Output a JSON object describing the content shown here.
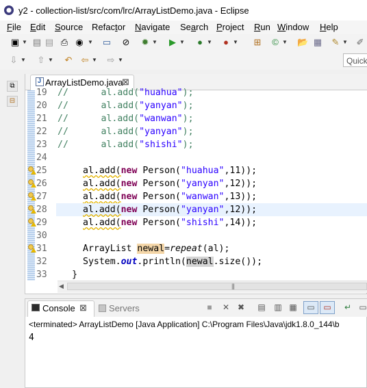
{
  "window": {
    "title": "y2 - collection-list/src/com/lrc/ArrayListDemo.java - Eclipse"
  },
  "menu": {
    "items": [
      {
        "underline": "F",
        "rest": "ile"
      },
      {
        "underline": "E",
        "rest": "dit"
      },
      {
        "underline": "S",
        "rest": "ource"
      },
      {
        "prefix": "Refac",
        "underline": "t",
        "rest": "or"
      },
      {
        "underline": "N",
        "rest": "avigate"
      },
      {
        "prefix": "Se",
        "underline": "a",
        "rest": "rch"
      },
      {
        "underline": "P",
        "rest": "roject"
      },
      {
        "underline": "R",
        "rest": "un"
      },
      {
        "underline": "W",
        "rest": "indow"
      },
      {
        "underline": "H",
        "rest": "elp"
      }
    ]
  },
  "toolbar": {
    "quick_access_placeholder": "Quick"
  },
  "editor": {
    "tab_label": "ArrayListDemo.java",
    "tab_close": "⊠",
    "lines": [
      {
        "num": "19",
        "kind": "comment",
        "text": "//      al.add(\"huahua\");"
      },
      {
        "num": "20",
        "kind": "comment",
        "text": "//      al.add(\"yanyan\");"
      },
      {
        "num": "21",
        "kind": "comment",
        "text": "//      al.add(\"wanwan\");"
      },
      {
        "num": "22",
        "kind": "comment",
        "text": "//      al.add(\"yanyan\");"
      },
      {
        "num": "23",
        "kind": "comment",
        "text": "//      al.add(\"shishi\");"
      },
      {
        "num": "24",
        "kind": "blank",
        "text": ""
      },
      {
        "num": "25",
        "kind": "add",
        "name": "huahua",
        "age": "11"
      },
      {
        "num": "26",
        "kind": "add",
        "name": "yanyan",
        "age": "12"
      },
      {
        "num": "27",
        "kind": "add",
        "name": "wanwan",
        "age": "13"
      },
      {
        "num": "28",
        "kind": "add",
        "name": "yanyan",
        "age": "12"
      },
      {
        "num": "29",
        "kind": "add",
        "name": "shishi",
        "age": "14"
      },
      {
        "num": "30",
        "kind": "blank",
        "text": ""
      },
      {
        "num": "31",
        "kind": "repeat"
      },
      {
        "num": "32",
        "kind": "println"
      },
      {
        "num": "33",
        "kind": "close"
      }
    ],
    "tokens": {
      "al": "al",
      "add": ".add(",
      "new": "new",
      "person": " Person(",
      "comma": ",",
      "end": "));",
      "arraylist": "ArrayList ",
      "newal": "newal",
      "assign": "=",
      "repeat": "repeat",
      "repeat_arg": "(al);",
      "system": "System.",
      "out": "out",
      "println": ".println(",
      "size": ".size());",
      "brace": "}"
    },
    "scroll_grip": "|||"
  },
  "console": {
    "tab_label": "Console",
    "tab_close": "⊠",
    "servers_label": "Servers",
    "terminated": "<terminated> ArrayListDemo [Java Application] C:\\Program Files\\Java\\jdk1.8.0_144\\b",
    "output": "4"
  },
  "colors": {
    "comment": "#3f7f5f",
    "string": "#2a00ff",
    "keyword": "#7f0055",
    "static_field": "#0000c0",
    "current_line": "#e8f2fe",
    "occurrence": "#f4d6a8"
  }
}
